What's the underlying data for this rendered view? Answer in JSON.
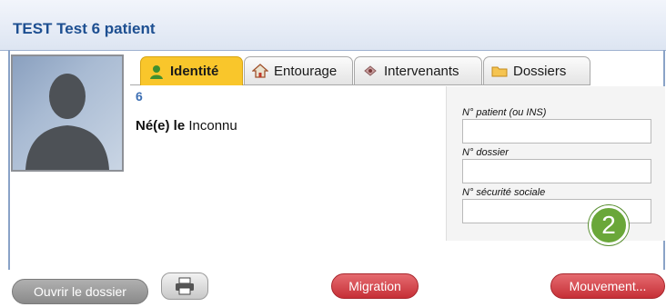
{
  "header": {
    "title": "TEST Test 6 patient"
  },
  "tabs": [
    {
      "label": "Identité",
      "icon": "user-icon",
      "active": true
    },
    {
      "label": "Entourage",
      "icon": "house-icon",
      "active": false
    },
    {
      "label": "Intervenants",
      "icon": "pin-icon",
      "active": false
    },
    {
      "label": "Dossiers",
      "icon": "folder-icon",
      "active": false
    }
  ],
  "patient": {
    "number": "6",
    "born_label": "Né(e) le",
    "born_value": "Inconnu"
  },
  "ids": {
    "patient_label": "N° patient (ou INS)",
    "patient_value": "",
    "dossier_label": "N° dossier",
    "dossier_value": "",
    "secu_label": "N° sécurité sociale",
    "secu_value": ""
  },
  "badge": "2",
  "buttons": {
    "open": "Ouvrir le dossier",
    "migration": "Migration",
    "mouvement": "Mouvement..."
  },
  "colors": {
    "title_blue": "#1d4f91",
    "active_tab": "#f9c62b",
    "red_button": "#c62f36",
    "badge_green": "#6aa739"
  }
}
